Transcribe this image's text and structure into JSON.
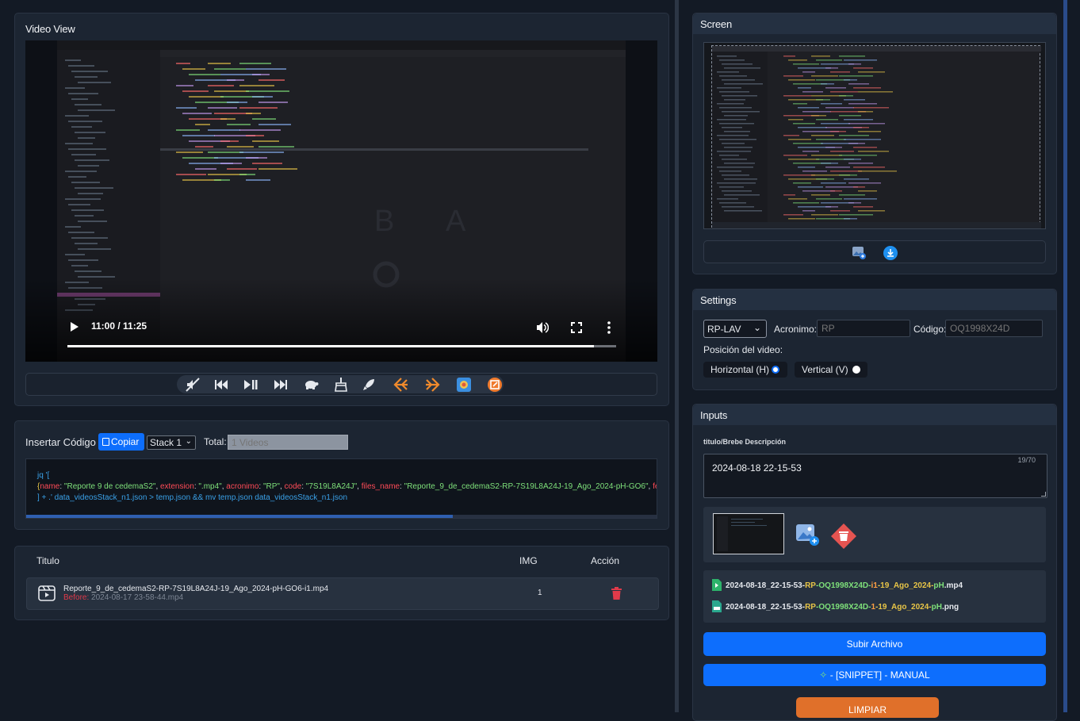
{
  "video_view": {
    "title": "Video View",
    "time": "11:00 / 11:25",
    "progress": 0.96,
    "toolbar": [
      "mute-icon",
      "skip-back-icon",
      "play-pause-icon",
      "skip-forward-icon",
      "turtle-icon",
      "broom-icon",
      "rocket-icon",
      "arrow-left-icon",
      "arrow-right-icon",
      "screenshot-icon",
      "stop-icon"
    ]
  },
  "code_panel": {
    "title": "Insertar Código",
    "copy_label": "Copiar",
    "stack_value": "Stack 1",
    "total_label": "Total:",
    "total_placeholder": "1 Videos",
    "line1": "jq '[",
    "line2_parts": [
      {
        "t": "{",
        "c": "#e8c547"
      },
      {
        "t": "name",
        "c": "#ff4b57"
      },
      {
        "t": ": ",
        "c": "#cfd3da"
      },
      {
        "t": "\"Reporte 9 de cedemaS2\"",
        "c": "#7ee07a"
      },
      {
        "t": ", ",
        "c": "#cfd3da"
      },
      {
        "t": "extension",
        "c": "#ff4b57"
      },
      {
        "t": ": ",
        "c": "#cfd3da"
      },
      {
        "t": "\".mp4\"",
        "c": "#7ee07a"
      },
      {
        "t": ", ",
        "c": "#cfd3da"
      },
      {
        "t": "acronimo",
        "c": "#ff4b57"
      },
      {
        "t": ": ",
        "c": "#cfd3da"
      },
      {
        "t": "\"RP\"",
        "c": "#7ee07a"
      },
      {
        "t": ", ",
        "c": "#cfd3da"
      },
      {
        "t": "code",
        "c": "#ff4b57"
      },
      {
        "t": ": ",
        "c": "#cfd3da"
      },
      {
        "t": "\"7S19L8A24J\"",
        "c": "#7ee07a"
      },
      {
        "t": ", ",
        "c": "#cfd3da"
      },
      {
        "t": "files_name",
        "c": "#ff4b57"
      },
      {
        "t": ": ",
        "c": "#cfd3da"
      },
      {
        "t": "\"Reporte_9_de_cedemaS2-RP-7S19L8A24J-19_Ago_2024-pH-GO6\"",
        "c": "#7ee07a"
      },
      {
        "t": ", ",
        "c": "#cfd3da"
      },
      {
        "t": "fecha:",
        "c": "#ff4b57"
      }
    ],
    "line3": "] + .' data_videosStack_n1.json > temp.json && mv temp.json data_videosStack_n1.json"
  },
  "table": {
    "headers": [
      "Titulo",
      "IMG",
      "Acción"
    ],
    "rows": [
      {
        "title": "Reporte_9_de_cedemaS2-RP-7S19L8A24J-19_Ago_2024-pH-GO6-i1.mp4",
        "before_label": "Before:",
        "before_value": "2024-08-17 23-58-44.mp4",
        "img": "1"
      }
    ]
  },
  "screen": {
    "title": "Screen"
  },
  "settings": {
    "title": "Settings",
    "select_value": "RP-LAV",
    "acronimo_label": "Acronimo:",
    "acronimo_placeholder": "RP",
    "codigo_label": "Código:",
    "codigo_placeholder": "OQ1998X24D",
    "position_label": "Posición del video:",
    "horizontal_label": "Horizontal (H)",
    "vertical_label": "Vertical (V)"
  },
  "inputs": {
    "title": "Inputs",
    "desc_label": "titulo/Brebe Descripción",
    "desc_value": "2024-08-18 22-15-53",
    "desc_counter": "19/70",
    "files": [
      {
        "parts": [
          {
            "t": "2024-08-18_22-15-53-",
            "c": "#e6e9ee"
          },
          {
            "t": "RP",
            "c": "#e8c547"
          },
          {
            "t": "-OQ1998X24D-",
            "c": "#7ee07a"
          },
          {
            "t": "i1",
            "c": "#ff9f43"
          },
          {
            "t": "-19_Ago_2024-",
            "c": "#e8c547"
          },
          {
            "t": "pH",
            "c": "#7ee07a"
          },
          {
            "t": ".mp4",
            "c": "#e6e9ee"
          }
        ]
      },
      {
        "parts": [
          {
            "t": "2024-08-18_22-15-53-",
            "c": "#e6e9ee"
          },
          {
            "t": "RP",
            "c": "#e8c547"
          },
          {
            "t": "-OQ1998X24D-",
            "c": "#7ee07a"
          },
          {
            "t": "1",
            "c": "#ff9f43"
          },
          {
            "t": "-19_Ago_2024-",
            "c": "#e8c547"
          },
          {
            "t": "pH",
            "c": "#7ee07a"
          },
          {
            "t": ".png",
            "c": "#e6e9ee"
          }
        ]
      }
    ],
    "upload_label": "Subir Archivo",
    "snippet_label": "- [SNIPPET] - MANUAL",
    "clear_label": "LIMPIAR"
  },
  "colors": {
    "accent": "#0d6efd",
    "danger": "#e03a4a",
    "orange": "#e0702a"
  }
}
